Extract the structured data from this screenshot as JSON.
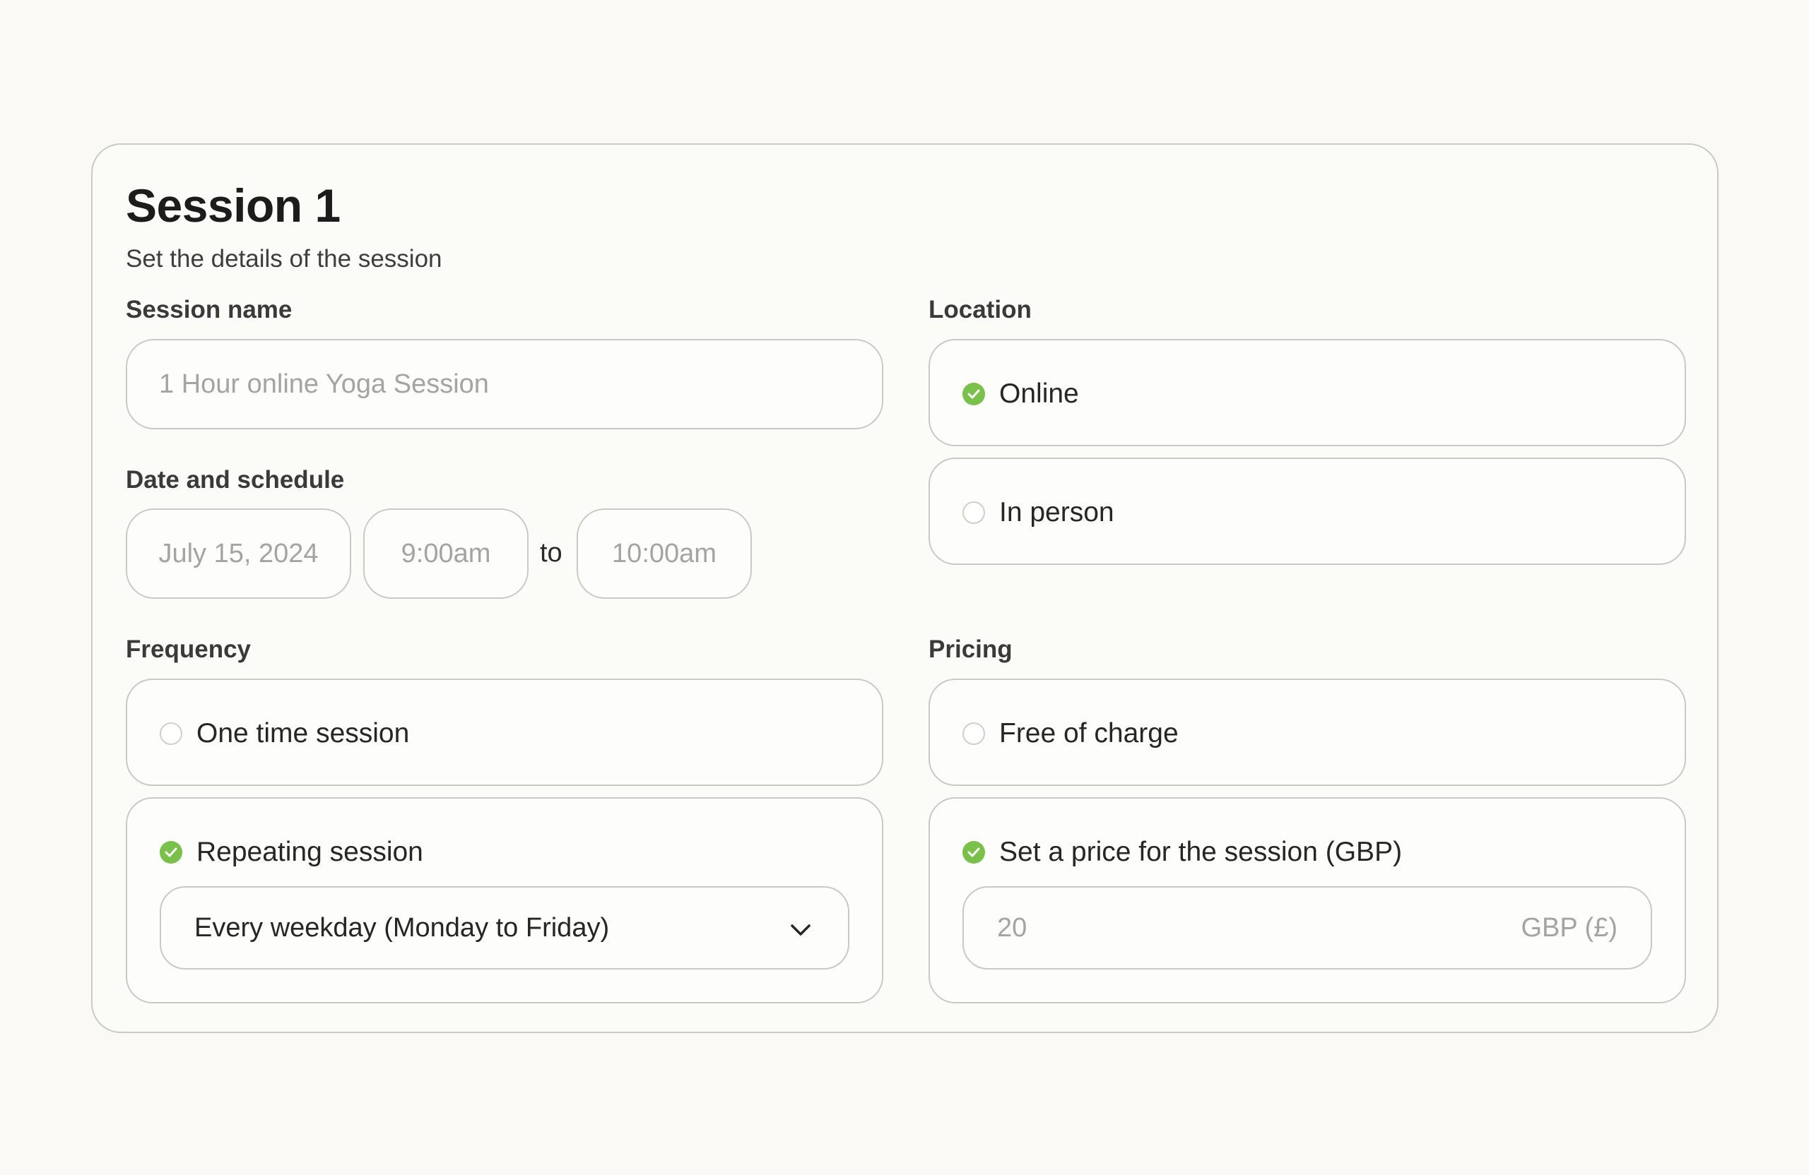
{
  "session": {
    "title": "Session 1",
    "subtitle": "Set the details of the session"
  },
  "session_name": {
    "label": "Session name",
    "placeholder": "1 Hour online Yoga Session"
  },
  "schedule": {
    "label": "Date and schedule",
    "date": "July 15, 2024",
    "start": "9:00am",
    "to": "to",
    "end": "10:00am"
  },
  "location": {
    "label": "Location",
    "options": [
      {
        "label": "Online",
        "selected": true
      },
      {
        "label": "In person",
        "selected": false
      }
    ]
  },
  "frequency": {
    "label": "Frequency",
    "options": [
      {
        "label": "One time session",
        "selected": false
      },
      {
        "label": "Repeating session",
        "selected": true
      }
    ],
    "repeat_value": "Every weekday (Monday to Friday)"
  },
  "pricing": {
    "label": "Pricing",
    "options": [
      {
        "label": "Free of charge",
        "selected": false
      },
      {
        "label": "Set a price for the session (GBP)",
        "selected": true
      }
    ],
    "price_placeholder": "20",
    "currency": "GBP (£)"
  },
  "colors": {
    "accent": "#79c14a",
    "border": "#c9c9c6",
    "background": "#faf9f5"
  },
  "icons": {
    "selected": "check-circle-icon",
    "unselected": "radio-empty-icon",
    "dropdown": "chevron-down-icon"
  }
}
